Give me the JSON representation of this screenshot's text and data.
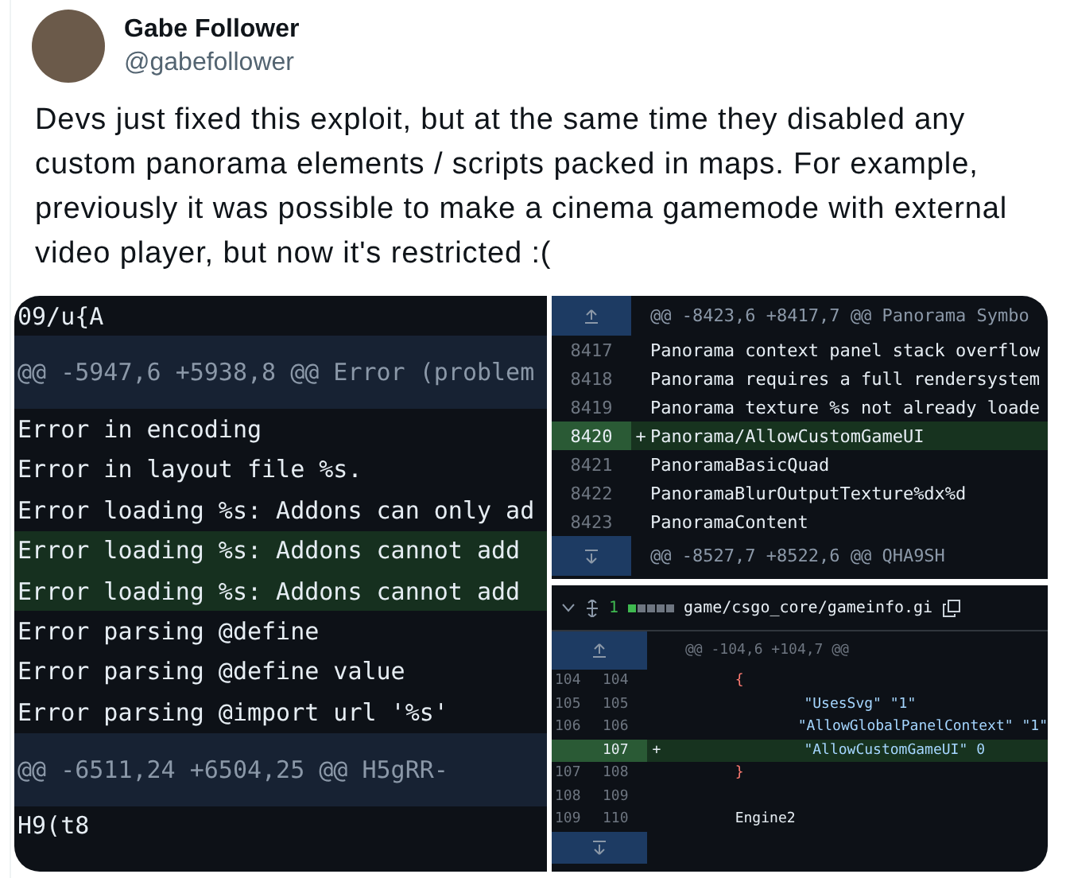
{
  "author": {
    "name": "Gabe Follower",
    "handle": "@gabefollower"
  },
  "text": "Devs just fixed this exploit, but at the same time they disabled any custom panorama elements / scripts packed in maps. For example, previously it was possible to make a cinema gamemode with external video player, but now it's restricted :(",
  "images": [
    {
      "kind": "diff_plain",
      "lines": [
        {
          "kind": "context",
          "text": "09/u{A"
        },
        {
          "kind": "hunk",
          "text": "@@ -5947,6 +5938,8 @@ Error (problem"
        },
        {
          "kind": "context",
          "text": "Error in encoding"
        },
        {
          "kind": "context",
          "text": "Error in layout file %s."
        },
        {
          "kind": "context",
          "text": "Error loading %s: Addons can only ad"
        },
        {
          "kind": "added",
          "text": "Error loading %s: Addons cannot add"
        },
        {
          "kind": "added",
          "text": "Error loading %s: Addons cannot add"
        },
        {
          "kind": "context",
          "text": "Error parsing @define"
        },
        {
          "kind": "context",
          "text": "Error parsing @define value"
        },
        {
          "kind": "context",
          "text": "Error parsing @import url '%s'"
        },
        {
          "kind": "hunk",
          "text": "@@ -6511,24 +6504,25 @@ H5gRR-"
        },
        {
          "kind": "context",
          "text": "H9(t8"
        }
      ]
    },
    {
      "kind": "diff_numbered",
      "lines": [
        {
          "kind": "hunk",
          "text": "@@ -8423,6 +8417,7 @@ Panorama Symbo"
        },
        {
          "kind": "context",
          "number": "8417",
          "text": "Panorama context panel stack overflow"
        },
        {
          "kind": "context",
          "number": "8418",
          "text": "Panorama requires a full rendersystem"
        },
        {
          "kind": "context",
          "number": "8419",
          "text": "Panorama texture %s not already loade"
        },
        {
          "kind": "added",
          "number": "8420",
          "sign": "+",
          "text": "Panorama/AllowCustomGameUI"
        },
        {
          "kind": "context",
          "number": "8421",
          "text": "PanoramaBasicQuad"
        },
        {
          "kind": "context",
          "number": "8422",
          "text": "PanoramaBlurOutputTexture%dx%d"
        },
        {
          "kind": "context",
          "number": "8423",
          "text": "PanoramaContent"
        },
        {
          "kind": "hunk",
          "text": "@@ -8527,7 +8522,6 @@ QHA9SH"
        }
      ]
    },
    {
      "kind": "diff_split",
      "file": {
        "count": "1",
        "path": "game/csgo_core/gameinfo.gi"
      },
      "lines": [
        {
          "kind": "hunk",
          "text": "@@ -104,6 +104,7 @@"
        },
        {
          "kind": "context",
          "old": "104",
          "new": "104",
          "color": "#ff7b72",
          "text": "        {"
        },
        {
          "kind": "context",
          "old": "105",
          "new": "105",
          "color": "#a5d6ff",
          "text": "                \"UsesSvg\" \"1\""
        },
        {
          "kind": "context",
          "old": "106",
          "new": "106",
          "color": "#a5d6ff",
          "text": "                \"AllowGlobalPanelContext\" \"1\""
        },
        {
          "kind": "added",
          "new": "107",
          "sign": "+",
          "color": "#a5d6ff",
          "text": "                \"AllowCustomGameUI\" 0"
        },
        {
          "kind": "context",
          "old": "107",
          "new": "108",
          "color": "#ff7b72",
          "text": "        }"
        },
        {
          "kind": "context",
          "old": "108",
          "new": "109"
        },
        {
          "kind": "context",
          "old": "109",
          "new": "110",
          "color": "#e6edf3",
          "text": "        Engine2"
        },
        {
          "kind": "footer"
        }
      ]
    }
  ]
}
